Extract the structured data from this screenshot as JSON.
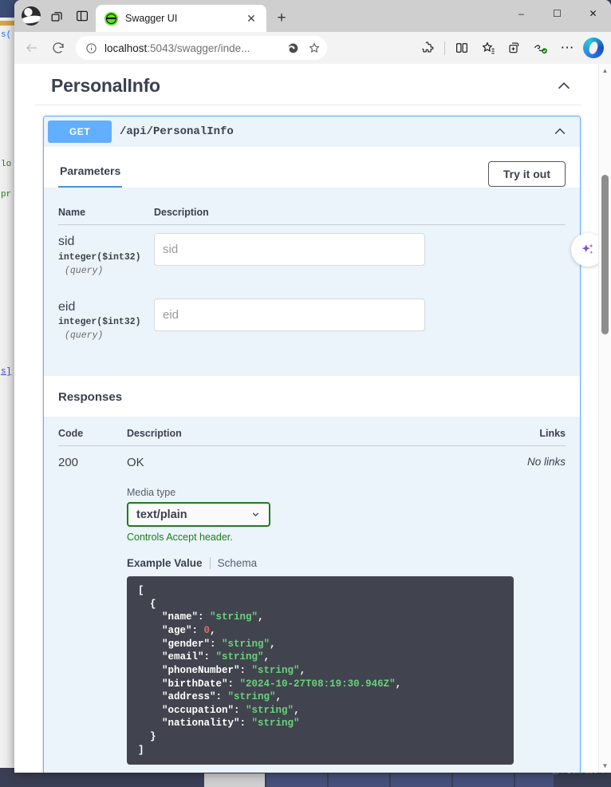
{
  "browser": {
    "tab": {
      "title": "Swagger UI",
      "favicon": "swagger-favicon",
      "close_label": "✕"
    },
    "newtab_label": "+",
    "window_controls": {
      "minimize": "–",
      "maximize": "☐",
      "close": "✕"
    },
    "nav": {
      "back": "←",
      "refresh": "⟳"
    },
    "address": {
      "host": "localhost",
      "path": ":5043/swagger/inde...",
      "full": "localhost:5043/swagger/inde...",
      "info_icon": "info-icon",
      "split_icon": "refresh-split-icon",
      "favorite_icon": "star-icon"
    },
    "toolbar": {
      "extensions": "extensions-icon",
      "split_screen": "split-screen-icon",
      "favorites": "favorites-icon",
      "collections": "collections-icon",
      "browser_essentials": "browser-essentials-icon",
      "settings": "⋯",
      "copilot": "copilot-icon"
    }
  },
  "swagger": {
    "tag_title": "PersonalInfo",
    "operation": {
      "method": "GET",
      "path": "/api/PersonalInfo",
      "collapse_icon": "chevron-up-icon"
    },
    "tabs": {
      "parameters": "Parameters",
      "try_it_out": "Try it out"
    },
    "parameters": {
      "headers": {
        "name": "Name",
        "description": "Description"
      },
      "rows": [
        {
          "name": "sid",
          "type": "integer($int32)",
          "location": "(query)",
          "placeholder": "sid",
          "value": ""
        },
        {
          "name": "eid",
          "type": "integer($int32)",
          "location": "(query)",
          "placeholder": "eid",
          "value": ""
        }
      ]
    },
    "responses": {
      "title": "Responses",
      "headers": {
        "code": "Code",
        "description": "Description",
        "links": "Links"
      },
      "rows": [
        {
          "code": "200",
          "description": "OK",
          "links": "No links",
          "media_type_label": "Media type",
          "media_type_value": "text/plain",
          "accept_note": "Controls Accept header.",
          "example_value_tab": "Example Value",
          "schema_tab": "Schema"
        }
      ]
    },
    "example_json": {
      "lines": [
        {
          "indent": 0,
          "parts": [
            {
              "t": "[",
              "c": "cp"
            }
          ]
        },
        {
          "indent": 1,
          "parts": [
            {
              "t": "{",
              "c": "cp"
            }
          ]
        },
        {
          "indent": 2,
          "parts": [
            {
              "t": "\"name\": ",
              "c": "ck"
            },
            {
              "t": "\"string\"",
              "c": "cs"
            },
            {
              "t": ",",
              "c": "cp"
            }
          ]
        },
        {
          "indent": 2,
          "parts": [
            {
              "t": "\"age\": ",
              "c": "ck"
            },
            {
              "t": "0",
              "c": "cn"
            },
            {
              "t": ",",
              "c": "cp"
            }
          ]
        },
        {
          "indent": 2,
          "parts": [
            {
              "t": "\"gender\": ",
              "c": "ck"
            },
            {
              "t": "\"string\"",
              "c": "cs"
            },
            {
              "t": ",",
              "c": "cp"
            }
          ]
        },
        {
          "indent": 2,
          "parts": [
            {
              "t": "\"email\": ",
              "c": "ck"
            },
            {
              "t": "\"string\"",
              "c": "cs"
            },
            {
              "t": ",",
              "c": "cp"
            }
          ]
        },
        {
          "indent": 2,
          "parts": [
            {
              "t": "\"phoneNumber\": ",
              "c": "ck"
            },
            {
              "t": "\"string\"",
              "c": "cs"
            },
            {
              "t": ",",
              "c": "cp"
            }
          ]
        },
        {
          "indent": 2,
          "parts": [
            {
              "t": "\"birthDate\": ",
              "c": "ck"
            },
            {
              "t": "\"2024-10-27T08:19:30.946Z\"",
              "c": "cs"
            },
            {
              "t": ",",
              "c": "cp"
            }
          ]
        },
        {
          "indent": 2,
          "parts": [
            {
              "t": "\"address\": ",
              "c": "ck"
            },
            {
              "t": "\"string\"",
              "c": "cs"
            },
            {
              "t": ",",
              "c": "cp"
            }
          ]
        },
        {
          "indent": 2,
          "parts": [
            {
              "t": "\"occupation\": ",
              "c": "ck"
            },
            {
              "t": "\"string\"",
              "c": "cs"
            },
            {
              "t": ",",
              "c": "cp"
            }
          ]
        },
        {
          "indent": 2,
          "parts": [
            {
              "t": "\"nationality\": ",
              "c": "ck"
            },
            {
              "t": "\"string\"",
              "c": "cs"
            }
          ]
        },
        {
          "indent": 1,
          "parts": [
            {
              "t": "}",
              "c": "cp"
            }
          ]
        },
        {
          "indent": 0,
          "parts": [
            {
              "t": "]",
              "c": "cp"
            }
          ]
        }
      ]
    },
    "copilot_fab": "copilot-sparkle-icon"
  },
  "desktop": {
    "watermark": "CSDN @河西石头",
    "editor_snippets": [
      "s(",
      "lo",
      "pr",
      "s]"
    ]
  },
  "colors": {
    "get_method": "#61affe",
    "opblock_border": "#61affe",
    "opblock_bg": "#ebf3fb",
    "tab_underline": "#4990e2",
    "media_select_border": "#1a7f1a",
    "accept_note": "#1a7f1a",
    "code_bg": "#41444e",
    "code_string": "#69d27b",
    "code_number": "#e06c63",
    "text_primary": "#3b4151"
  }
}
